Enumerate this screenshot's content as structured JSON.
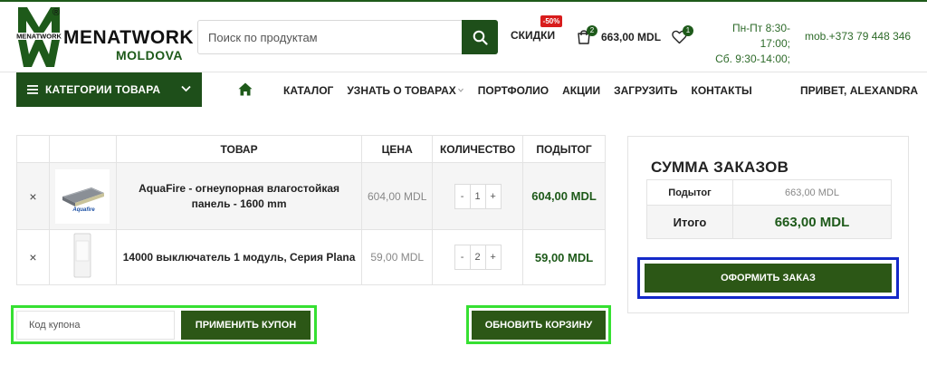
{
  "header": {
    "logo": {
      "mark": "MW",
      "reg": "®",
      "name": "MENATWORK",
      "country": "MOLDOVA"
    },
    "search": {
      "placeholder": "Поиск по продуктам"
    },
    "discounts": {
      "label": "СКИДКИ",
      "badge": "-50%"
    },
    "cart": {
      "count": "2",
      "total": "663,00 MDL"
    },
    "wishlist": {
      "count": "1"
    },
    "hours": {
      "weekdays": "Пн-Пт 8:30-17:00;",
      "saturday": "Сб. 9:30-14:00;"
    },
    "phone": "mob.+373 79 448 346"
  },
  "nav": {
    "categories_label": "КАТЕГОРИИ ТОВАРА",
    "items": [
      "КАТАЛОГ",
      "УЗНАТЬ О ТОВАРАХ",
      "ПОРТФОЛИО",
      "АКЦИИ",
      "ЗАГРУЗИТЬ",
      "КОНТАКТЫ"
    ],
    "greeting": "ПРИВЕТ, ALEXANDRA"
  },
  "cart_table": {
    "headers": {
      "product": "ТОВАР",
      "price": "ЦЕНА",
      "quantity": "КОЛИЧЕСТВО",
      "subtotal": "ПОДЫТОГ"
    },
    "rows": [
      {
        "remove": "×",
        "image_label": "Aquafire",
        "name": "AquaFire - огнеупорная влагостойкая панель - 1600 mm",
        "price": "604,00 MDL",
        "qty": "1",
        "subtotal": "604,00 MDL"
      },
      {
        "remove": "×",
        "name": "14000 выключатель 1 модуль, Серия Plana",
        "price": "59,00 MDL",
        "qty": "2",
        "subtotal": "59,00 MDL"
      }
    ],
    "minus": "-",
    "plus": "+"
  },
  "coupon": {
    "placeholder": "Код купона",
    "apply_label": "ПРИМЕНИТЬ КУПОН"
  },
  "update_label": "ОБНОВИТЬ КОРЗИНУ",
  "totals": {
    "title": "СУММА ЗАКАЗОВ",
    "subtotal_label": "Подытог",
    "subtotal_value": "663,00 MDL",
    "total_label": "Итого",
    "total_value": "663,00 MDL",
    "checkout_label": "ОФОРМИТЬ ЗАКАЗ"
  },
  "colors": {
    "brand_green": "#1e4f1a",
    "button_green": "#2c5716",
    "accent_text_green": "#2e6b2a",
    "badge_red": "#d81c1c",
    "highlight_green": "#36e032",
    "highlight_blue": "#1429c9"
  }
}
